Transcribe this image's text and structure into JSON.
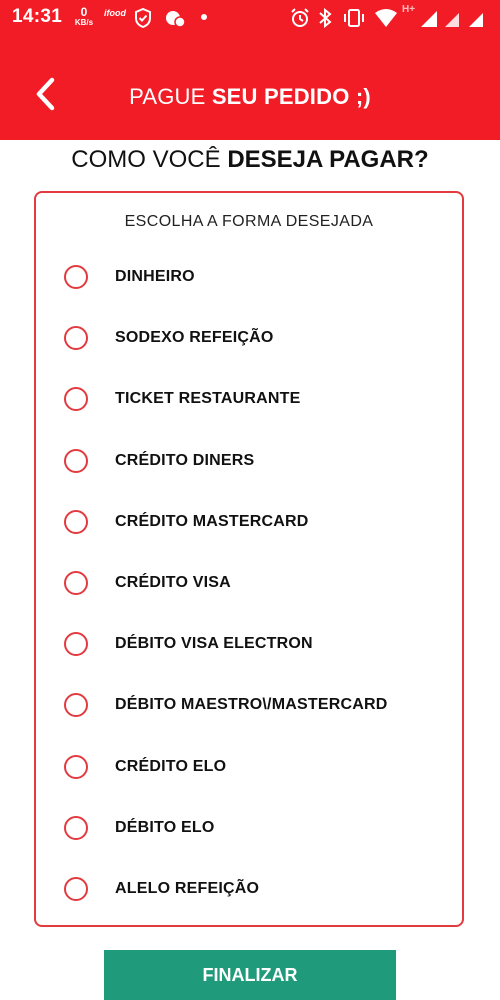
{
  "status_bar": {
    "time": "14:31",
    "speed_value": "0",
    "speed_unit": "KB/s",
    "app_tag": "ifood",
    "network": "H+"
  },
  "header": {
    "title_prefix": "PAGUE ",
    "title_bold": "SEU PEDIDO ;)",
    "background_color": "#f21c26"
  },
  "page": {
    "title_prefix": "COMO VOCÊ ",
    "title_bold": "DESEJA PAGAR?"
  },
  "payment": {
    "heading": "ESCOLHA A FORMA DESEJADA",
    "accent_color": "#e23a3f",
    "options": [
      {
        "label": "DINHEIRO",
        "selected": false
      },
      {
        "label": "SODEXO REFEIÇÃO",
        "selected": false
      },
      {
        "label": "TICKET RESTAURANTE",
        "selected": false
      },
      {
        "label": "CRÉDITO DINERS",
        "selected": false
      },
      {
        "label": "CRÉDITO MASTERCARD",
        "selected": false
      },
      {
        "label": "CRÉDITO VISA",
        "selected": false
      },
      {
        "label": "DÉBITO VISA ELECTRON",
        "selected": false
      },
      {
        "label": "DÉBITO MAESTRO\\/MASTERCARD",
        "selected": false
      },
      {
        "label": "CRÉDITO ELO",
        "selected": false
      },
      {
        "label": "DÉBITO ELO",
        "selected": false
      },
      {
        "label": "ALELO REFEIÇÃO",
        "selected": false
      }
    ]
  },
  "footer": {
    "finalize_label": "FINALIZAR",
    "button_color": "#1f9a7a"
  }
}
